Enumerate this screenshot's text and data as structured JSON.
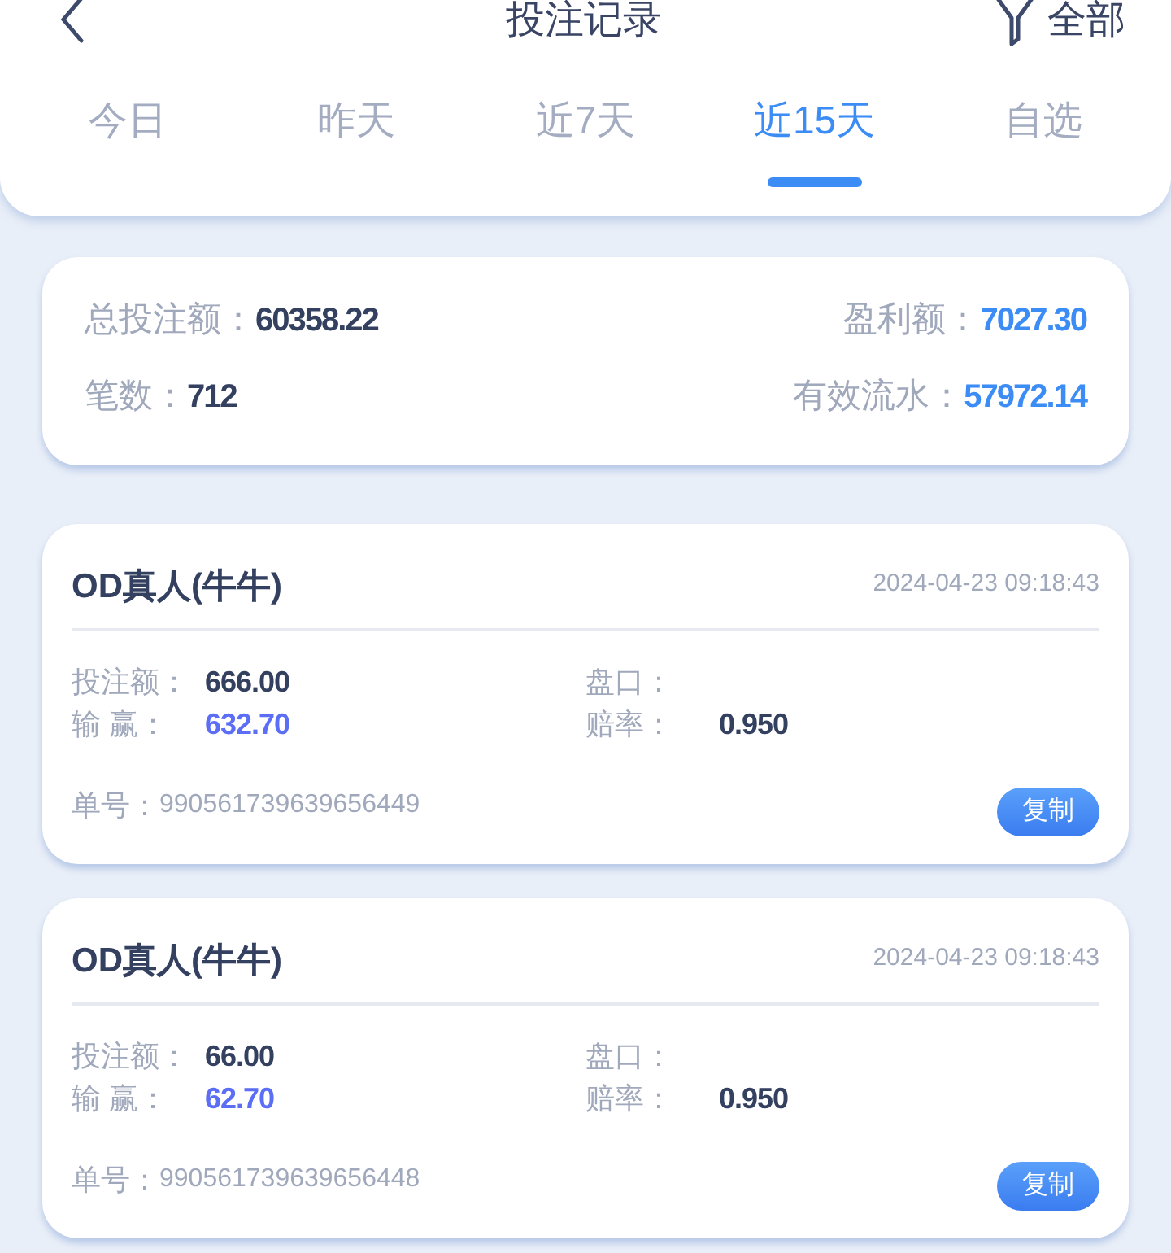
{
  "header": {
    "title": "投注记录",
    "filter_label": "全部"
  },
  "tabs": [
    {
      "label": "今日",
      "selected": false
    },
    {
      "label": "昨天",
      "selected": false
    },
    {
      "label": "近7天",
      "selected": false
    },
    {
      "label": "近15天",
      "selected": true
    },
    {
      "label": "自选",
      "selected": false
    }
  ],
  "summary": [
    {
      "label": "总投注额：",
      "value": "60358.22",
      "highlight": false
    },
    {
      "label": "盈利额：",
      "value": "7027.30",
      "highlight": true
    },
    {
      "label": "笔数：",
      "value": "712",
      "highlight": false
    },
    {
      "label": "有效流水：",
      "value": "57972.14",
      "highlight": true
    }
  ],
  "records": [
    {
      "game": "OD真人(牛牛)",
      "time": "2024-04-23 09:18:43",
      "bet_label": "投注额：",
      "bet": "666.00",
      "handicap_label": "盘口：",
      "win_label": "输 赢：",
      "win": "632.70",
      "odds_label": "赔率：",
      "odds": "0.950",
      "order_label": "单号：",
      "order": "990561739639656449",
      "copy_button": "复制"
    },
    {
      "game": "OD真人(牛牛)",
      "time": "2024-04-23 09:18:43",
      "bet_label": "投注额：",
      "bet": "66.00",
      "handicap_label": "盘口：",
      "win_label": "输 赢：",
      "win": "62.70",
      "odds_label": "赔率：",
      "odds": "0.950",
      "order_label": "单号：",
      "order": "990561739639656448",
      "copy_button": "复制"
    }
  ]
}
